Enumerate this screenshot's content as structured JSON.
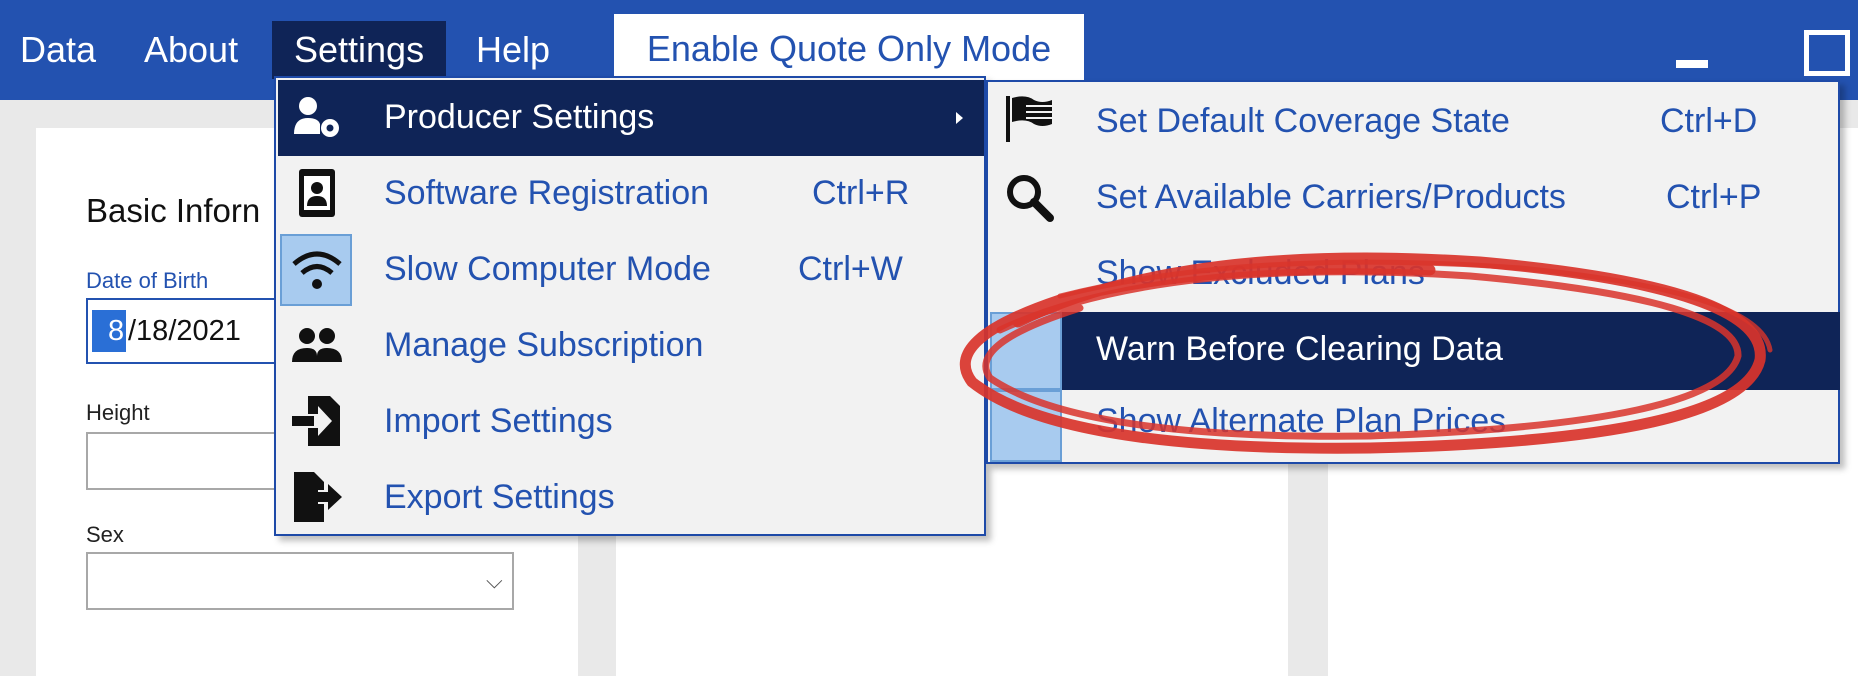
{
  "menubar": {
    "items": [
      {
        "label": "Data"
      },
      {
        "label": "About"
      },
      {
        "label": "Settings"
      },
      {
        "label": "Help"
      }
    ],
    "enable_quote_mode": "Enable Quote Only Mode"
  },
  "form": {
    "title": "Basic Inforn",
    "dob_label": "Date of Birth",
    "dob_value_selected": "8",
    "dob_value_rest": "/18/2021",
    "height_label": "Height",
    "sex_label": "Sex",
    "sex_value": ""
  },
  "settings_menu": {
    "items": [
      {
        "label": "Producer Settings",
        "shortcut": ""
      },
      {
        "label": "Software Registration",
        "shortcut": "Ctrl+R"
      },
      {
        "label": "Slow Computer Mode",
        "shortcut": "Ctrl+W"
      },
      {
        "label": "Manage Subscription",
        "shortcut": ""
      },
      {
        "label": "Import Settings",
        "shortcut": ""
      },
      {
        "label": "Export Settings",
        "shortcut": ""
      }
    ]
  },
  "producer_submenu": {
    "items": [
      {
        "label": "Set Default Coverage State",
        "shortcut": "Ctrl+D"
      },
      {
        "label": "Set Available Carriers/Products",
        "shortcut": "Ctrl+P"
      },
      {
        "label": "Show Excluded Plans",
        "shortcut": ""
      },
      {
        "label": "Warn Before Clearing Data",
        "shortcut": ""
      },
      {
        "label": "Show Alternate Plan Prices",
        "shortcut": ""
      }
    ]
  },
  "colors": {
    "menubar": "#2352b0",
    "highlight": "#0f2457",
    "menu_text": "#2352b0",
    "annotation": "#d9342b"
  },
  "icons": {
    "producer_settings": "user-gear-icon",
    "software_registration": "id-badge-icon",
    "slow_computer_mode": "wifi-icon",
    "manage_subscription": "users-icon",
    "import_settings": "file-import-icon",
    "export_settings": "file-export-icon",
    "coverage_state": "flag-icon",
    "carriers": "search-icon"
  }
}
